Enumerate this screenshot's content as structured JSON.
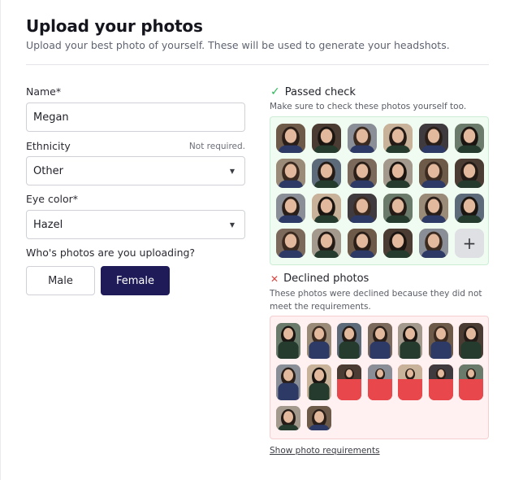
{
  "header": {
    "title": "Upload your photos",
    "subtitle": "Upload your best photo of yourself. These will be used to generate your headshots."
  },
  "form": {
    "name_label": "Name*",
    "name_value": "Megan",
    "ethnicity_label": "Ethnicity",
    "ethnicity_hint": "Not required.",
    "ethnicity_value": "Other",
    "eye_color_label": "Eye color*",
    "eye_color_value": "Hazel",
    "gender_question": "Who's photos are you uploading?",
    "gender_options": [
      "Male",
      "Female"
    ],
    "gender_selected": "Female"
  },
  "passed": {
    "title": "Passed check",
    "note": "Make sure to check these photos yourself too.",
    "photo_count": 23,
    "add_label": "+"
  },
  "declined": {
    "title": "Declined photos",
    "note_line1": "These photos were declined because they did not",
    "note_line2": "meet the requirements.",
    "photo_count": 16
  },
  "footer": {
    "link_label": "Show photo requirements"
  },
  "colors": {
    "accent": "#1e1b58",
    "passed_bg": "#f0fcf2",
    "declined_bg": "#fff1f1",
    "check": "#2fb95a",
    "cross": "#e2433f"
  }
}
